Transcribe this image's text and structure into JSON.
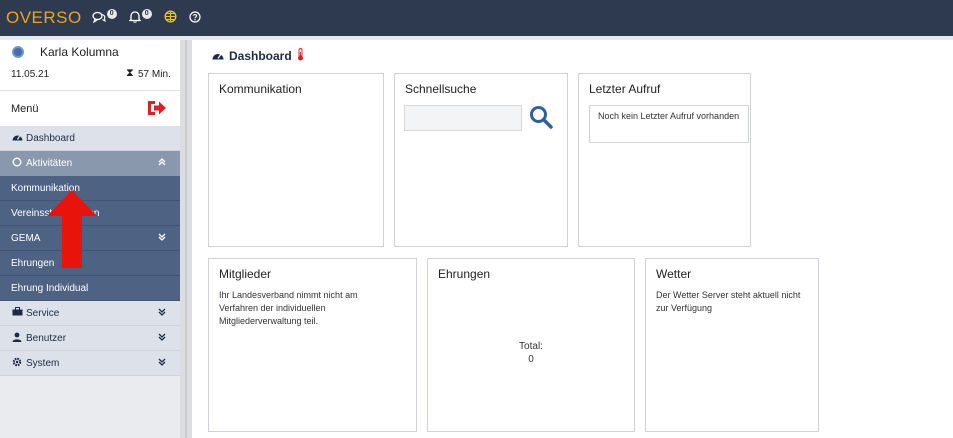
{
  "topbar": {
    "brand": "OVERSO",
    "messages_badge": "0",
    "notifications_badge": "0"
  },
  "user": {
    "name": "Karla Kolumna",
    "date": "11.05.21",
    "session": "57 Min."
  },
  "menu": {
    "label": "Menü"
  },
  "nav": {
    "items": [
      {
        "label": "Dashboard",
        "icon": "tachometer-icon"
      },
      {
        "label": "Aktivitäten",
        "icon": "circle-icon"
      },
      {
        "label": "Kommunikation"
      },
      {
        "label": "Vereinsstammdaten"
      },
      {
        "label": "GEMA"
      },
      {
        "label": "Ehrungen"
      },
      {
        "label": "Ehrung Individual"
      },
      {
        "label": "Service",
        "icon": "briefcase-icon"
      },
      {
        "label": "Benutzer",
        "icon": "user-icon"
      },
      {
        "label": "System",
        "icon": "cog-icon"
      }
    ]
  },
  "main": {
    "title": "Dashboard",
    "cards": {
      "kommunikation": {
        "title": "Kommunikation"
      },
      "schnellsuche": {
        "title": "Schnellsuche",
        "placeholder": ""
      },
      "letzter_aufruf": {
        "title": "Letzter Aufruf",
        "text": "Noch kein Letzter Aufruf vorhanden"
      },
      "mitglieder": {
        "title": "Mitglieder",
        "text": "Ihr Landesverband nimmt nicht am Verfahren der individuellen Mitgliederverwaltung teil."
      },
      "ehrungen": {
        "title": "Ehrungen",
        "total_label": "Total:",
        "total_value": "0"
      },
      "wetter": {
        "title": "Wetter",
        "text": "Der Wetter Server steht aktuell nicht zur Verfügung"
      }
    }
  },
  "colors": {
    "topbar": "#2d3a4f",
    "brand": "#f0a21c",
    "nav_dark": "#4e6283",
    "nav_mid": "#8a98ad",
    "arrow": "#e8140c",
    "logout": "#e02020"
  }
}
